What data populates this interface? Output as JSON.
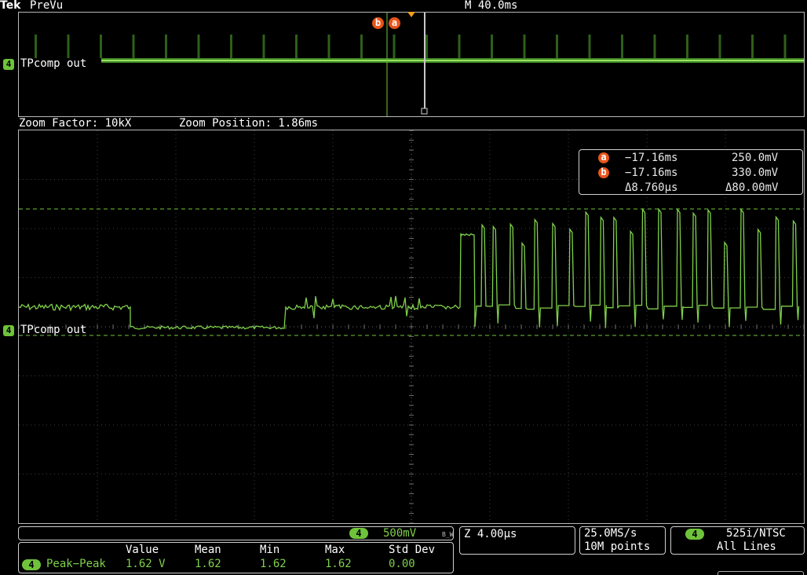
{
  "header": {
    "brand": "Tek",
    "mode": "PreVu",
    "timebase": "M 40.0ms"
  },
  "overview": {
    "channel_number": "4",
    "channel_label": "TPcomp out",
    "cursor_b": "b",
    "cursor_a": "a"
  },
  "zoom": {
    "factor": "Zoom Factor: 10kX",
    "position": "Zoom Position: 1.86ms"
  },
  "main": {
    "channel_number": "4",
    "channel_label": "TPcomp out"
  },
  "cursor_readout": {
    "a_label": "a",
    "a_time": "−17.16ms",
    "a_value": "250.0mV",
    "b_label": "b",
    "b_time": "−17.16ms",
    "b_value": "330.0mV",
    "delta_time": "Δ8.760µs",
    "delta_value": "Δ80.00mV"
  },
  "status": {
    "channel_number": "4",
    "scale": "500mV",
    "bw_flag": "B_W",
    "zoom_scale": "Z 4.00µs",
    "sample_rate": "25.0MS/s",
    "record_length": "10M points",
    "trigger_channel": "4",
    "trigger_standard": "525i/NTSC",
    "trigger_lines": "All Lines"
  },
  "measurements": {
    "headers": [
      "Value",
      "Mean",
      "Min",
      "Max",
      "Std Dev"
    ],
    "rows": [
      {
        "channel": "4",
        "name": "Peak−Peak",
        "value": "1.62 V",
        "mean": "1.62",
        "min": "1.62",
        "max": "1.62",
        "std_dev": "0.00"
      }
    ]
  },
  "colors": {
    "trace": "#7fd04a",
    "marker": "#e8541b",
    "trigger": "#f0a020",
    "grid": "#5a5a5a",
    "border": "#b8b8b8"
  }
}
